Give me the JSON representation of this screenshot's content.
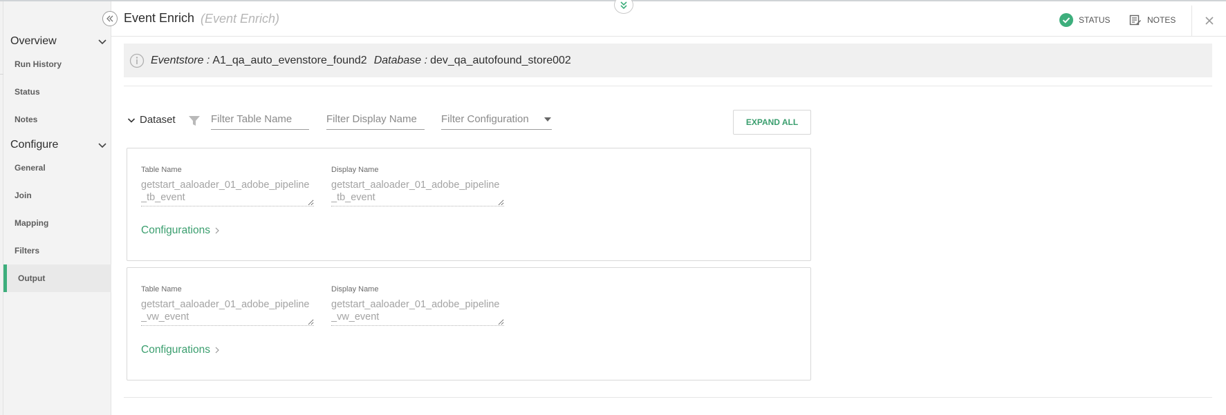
{
  "header": {
    "title": "Event Enrich",
    "subtitle": "(Event Enrich)",
    "status_label": "STATUS",
    "notes_label": "NOTES"
  },
  "sidebar": {
    "sections": [
      {
        "label": "Overview",
        "items": [
          "Run History",
          "Status",
          "Notes"
        ]
      },
      {
        "label": "Configure",
        "items": [
          "General",
          "Join",
          "Mapping",
          "Filters",
          "Output"
        ]
      }
    ],
    "active_item": "Output"
  },
  "info": {
    "eventstore_label": "Eventstore :",
    "eventstore_value": "A1_qa_auto_evenstore_found2",
    "database_label": "Database :",
    "database_value": "dev_qa_autofound_store002"
  },
  "filters": {
    "dataset_label": "Dataset",
    "table_name_placeholder": "Filter Table Name",
    "display_name_placeholder": "Filter Display Name",
    "configuration_placeholder": "Filter Configuration",
    "expand_all_label": "EXPAND ALL"
  },
  "datasets": [
    {
      "table_name_label": "Table Name",
      "table_name": "getstart_aaloader_01_adobe_pipeline_tb_event",
      "display_name_label": "Display Name",
      "display_name": "getstart_aaloader_01_adobe_pipeline_tb_event",
      "configurations_label": "Configurations"
    },
    {
      "table_name_label": "Table Name",
      "table_name": "getstart_aaloader_01_adobe_pipeline_vw_event",
      "display_name_label": "Display Name",
      "display_name": "getstart_aaloader_01_adobe_pipeline_vw_event",
      "configurations_label": "Configurations"
    }
  ],
  "colors": {
    "accent": "#3a9e6e",
    "active_bar": "#3dae7c",
    "status_ok": "#3dae7c"
  },
  "icons": {
    "collapse": "double-chevron-left-icon",
    "top_toggle": "double-chevron-down-icon",
    "status": "check-circle-icon",
    "notes": "notes-icon",
    "close": "close-icon",
    "info": "info-icon",
    "filter": "filter-icon",
    "dropdown": "caret-down-icon",
    "link": "chevron-right-icon"
  }
}
